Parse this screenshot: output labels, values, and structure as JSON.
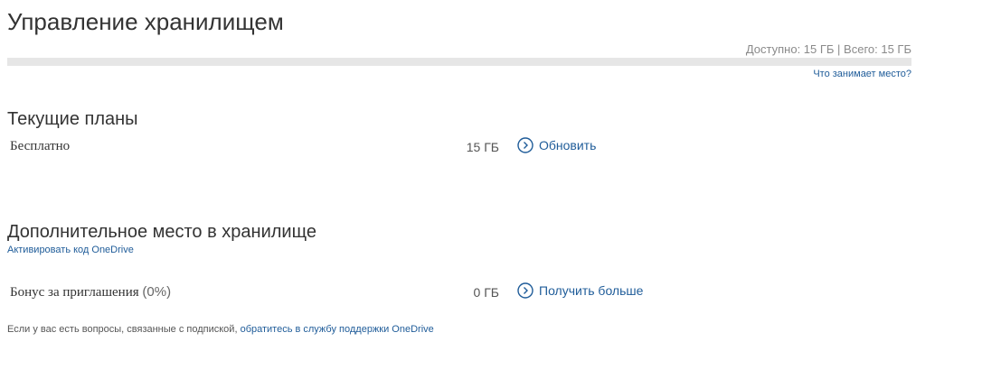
{
  "header": {
    "title": "Управление хранилищем"
  },
  "storage": {
    "summary": "Доступно: 15 ГБ | Всего: 15 ГБ",
    "used_fraction": 0,
    "what_takes_space_link": "Что занимает место?"
  },
  "current_plans": {
    "title": "Текущие планы",
    "rows": [
      {
        "name": "Бесплатно",
        "size": "15 ГБ",
        "action": "Обновить"
      }
    ]
  },
  "additional": {
    "title": "Дополнительное место в хранилище",
    "activate_link": "Активировать код OneDrive",
    "rows": [
      {
        "name": "Бонус за приглашения",
        "percent": "(0%)",
        "size": "0 ГБ",
        "action": "Получить больше"
      }
    ]
  },
  "footer": {
    "text": "Если у вас есть вопросы, связанные с подпиской,",
    "link": "обратитесь в службу поддержки OneDrive"
  },
  "colors": {
    "link": "#1f5c99",
    "bar_track": "#e6e6e6",
    "bar_fill": "#0072c6"
  }
}
